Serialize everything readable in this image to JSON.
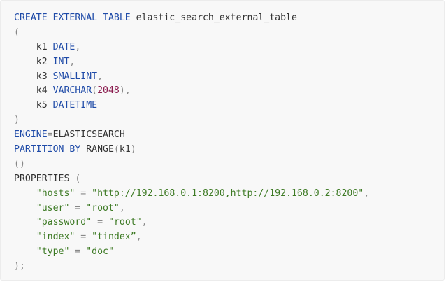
{
  "code": {
    "lines": [
      [
        {
          "t": "CREATE EXTERNAL TABLE",
          "c": "kw"
        },
        {
          "t": " elastic_search_external_table",
          "c": "pl"
        }
      ],
      [
        {
          "t": "(",
          "c": "pn"
        }
      ],
      [
        {
          "t": "    k1 ",
          "c": "pl"
        },
        {
          "t": "DATE",
          "c": "ty"
        },
        {
          "t": ",",
          "c": "pn"
        }
      ],
      [
        {
          "t": "    k2 ",
          "c": "pl"
        },
        {
          "t": "INT",
          "c": "ty"
        },
        {
          "t": ",",
          "c": "pn"
        }
      ],
      [
        {
          "t": "    k3 ",
          "c": "pl"
        },
        {
          "t": "SMALLINT",
          "c": "ty"
        },
        {
          "t": ",",
          "c": "pn"
        }
      ],
      [
        {
          "t": "    k4 ",
          "c": "pl"
        },
        {
          "t": "VARCHAR",
          "c": "ty"
        },
        {
          "t": "(",
          "c": "pn"
        },
        {
          "t": "2048",
          "c": "nm"
        },
        {
          "t": "),",
          "c": "pn"
        }
      ],
      [
        {
          "t": "    k5 ",
          "c": "pl"
        },
        {
          "t": "DATETIME",
          "c": "ty"
        }
      ],
      [
        {
          "t": ")",
          "c": "pn"
        }
      ],
      [
        {
          "t": "ENGINE",
          "c": "kw"
        },
        {
          "t": "=",
          "c": "pn"
        },
        {
          "t": "ELASTICSEARCH",
          "c": "pl"
        }
      ],
      [
        {
          "t": "PARTITION BY",
          "c": "kw"
        },
        {
          "t": " RANGE",
          "c": "pl"
        },
        {
          "t": "(",
          "c": "pn"
        },
        {
          "t": "k1",
          "c": "pl"
        },
        {
          "t": ")",
          "c": "pn"
        }
      ],
      [
        {
          "t": "()",
          "c": "pn"
        }
      ],
      [
        {
          "t": "PROPERTIES ",
          "c": "pl"
        },
        {
          "t": "(",
          "c": "pn"
        }
      ],
      [
        {
          "t": "    ",
          "c": "pl"
        },
        {
          "t": "\"hosts\"",
          "c": "st"
        },
        {
          "t": " = ",
          "c": "pn"
        },
        {
          "t": "\"http://192.168.0.1:8200,http://192.168.0.2:8200\"",
          "c": "st"
        },
        {
          "t": ",",
          "c": "pn"
        }
      ],
      [
        {
          "t": "    ",
          "c": "pl"
        },
        {
          "t": "\"user\"",
          "c": "st"
        },
        {
          "t": " = ",
          "c": "pn"
        },
        {
          "t": "\"root\"",
          "c": "st"
        },
        {
          "t": ",",
          "c": "pn"
        }
      ],
      [
        {
          "t": "    ",
          "c": "pl"
        },
        {
          "t": "\"password\"",
          "c": "st"
        },
        {
          "t": " = ",
          "c": "pn"
        },
        {
          "t": "\"root\"",
          "c": "st"
        },
        {
          "t": ",",
          "c": "pn"
        }
      ],
      [
        {
          "t": "    ",
          "c": "pl"
        },
        {
          "t": "\"index\"",
          "c": "st"
        },
        {
          "t": " = ",
          "c": "pn"
        },
        {
          "t": "\"tindex”",
          "c": "st"
        },
        {
          "t": ",",
          "c": "pn"
        }
      ],
      [
        {
          "t": "    ",
          "c": "pl"
        },
        {
          "t": "\"type\"",
          "c": "st"
        },
        {
          "t": " = ",
          "c": "pn"
        },
        {
          "t": "\"doc\"",
          "c": "st"
        }
      ],
      [
        {
          "t": ");",
          "c": "pn"
        }
      ]
    ]
  },
  "colors": {
    "keyword": "#1f4ba8",
    "type": "#1f4ba8",
    "plain": "#333333",
    "punctuation": "#888888",
    "number": "#8a1b4e",
    "string": "#3d7a24",
    "background": "#f8f8f8"
  }
}
